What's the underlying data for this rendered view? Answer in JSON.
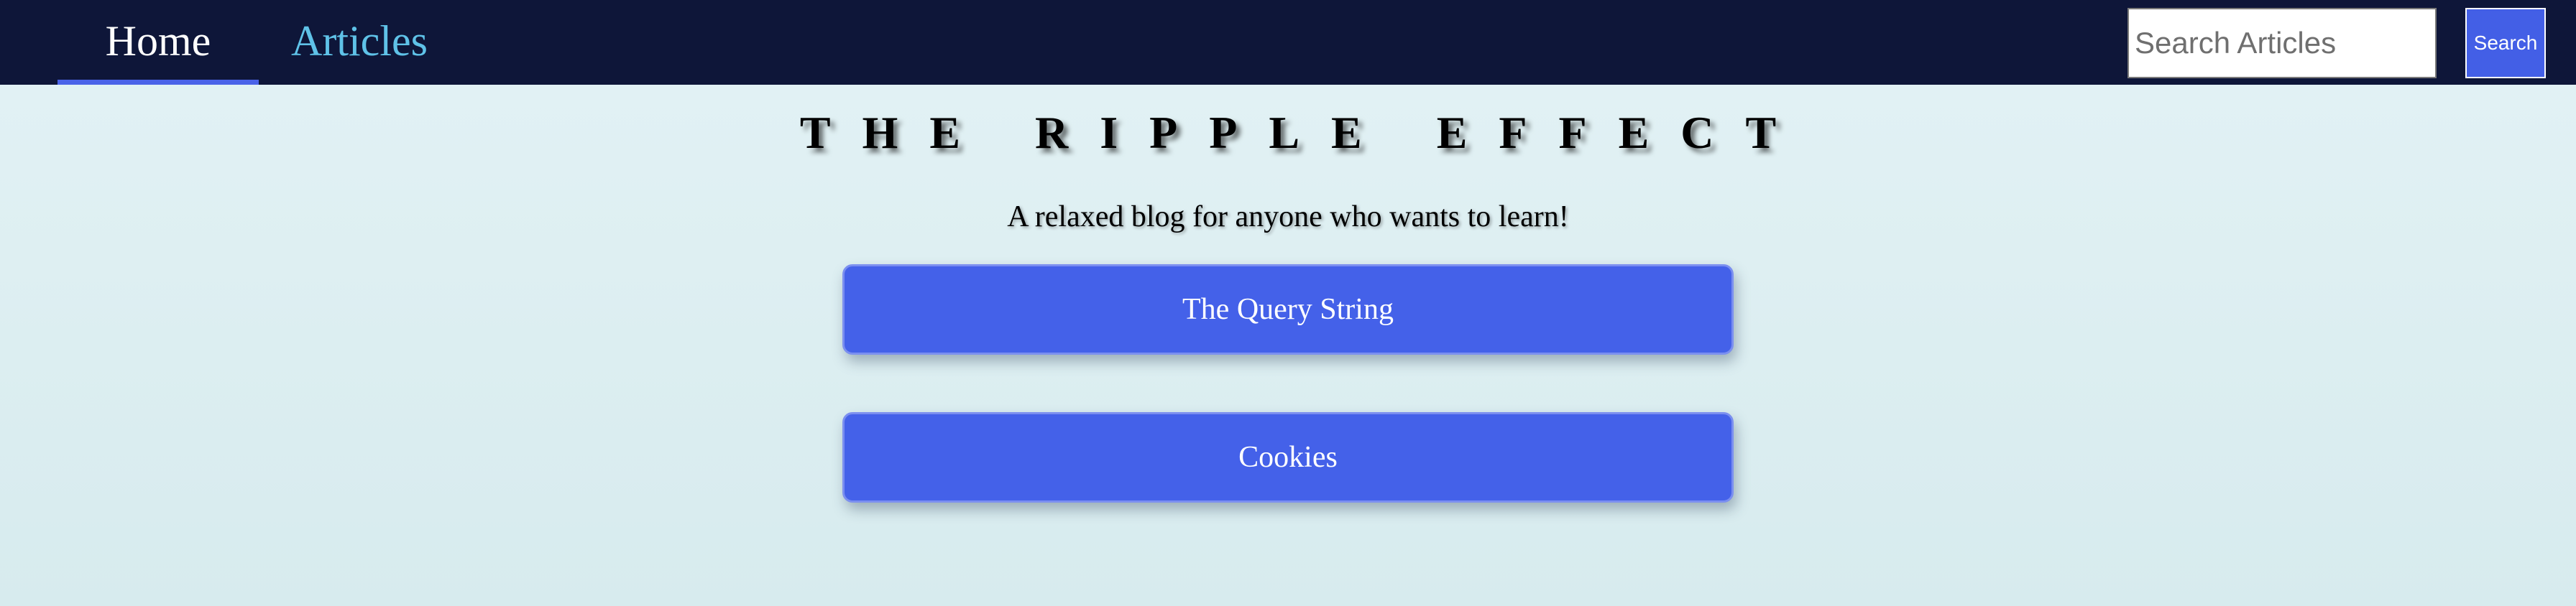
{
  "nav": {
    "links": [
      {
        "label": "Home",
        "active": true
      },
      {
        "label": "Articles",
        "active": false
      }
    ],
    "search": {
      "placeholder": "Search Articles",
      "value": "",
      "button_label": "Search"
    }
  },
  "header": {
    "title": "THE RIPPLE EFFECT",
    "tagline": "A relaxed blog for anyone who wants to learn!"
  },
  "articles": [
    {
      "title": "The Query String"
    },
    {
      "title": "Cookies"
    }
  ],
  "colors": {
    "navbar_bg": "#0e1639",
    "nav_active_text": "#ffffff",
    "nav_inactive_text": "#5fc2e8",
    "nav_active_underline": "#4a63e8",
    "card_bg": "#4461e9",
    "page_bg": "#e0f0f3"
  }
}
